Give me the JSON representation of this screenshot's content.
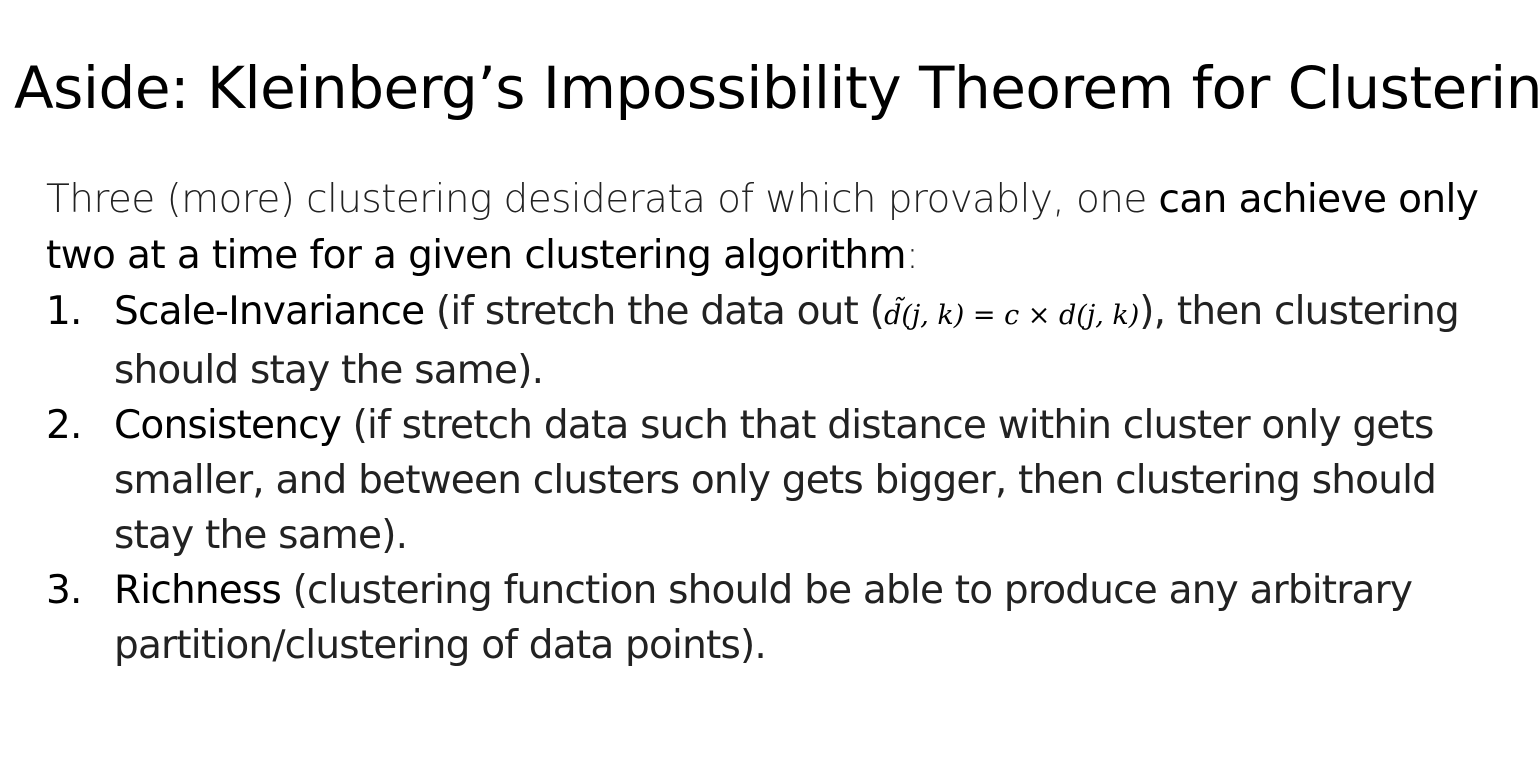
{
  "slide": {
    "title": "Aside: Kleinberg’s Impossibility Theorem for Clustering",
    "intro": {
      "light": "Three (more) clustering desiderata of which provably, one ",
      "strong": "can achieve only two at a time for a given clustering algorithm",
      "tail": ":"
    },
    "items": [
      {
        "number": "1.",
        "term": "Scale-Invariance",
        "desc_before": " (if stretch the data out (",
        "formula": "d̃(j, k) = c × d(j, k)",
        "desc_after": "), then clustering should stay the same)."
      },
      {
        "number": "2.",
        "term": "Consistency",
        "desc": " (if stretch data such that distance within cluster only gets smaller, and between clusters only gets bigger, then clustering should stay the same)."
      },
      {
        "number": "3.",
        "term": "Richness",
        "desc": " (clustering function should be able to produce any arbitrary partition/clustering of data points)."
      }
    ]
  }
}
